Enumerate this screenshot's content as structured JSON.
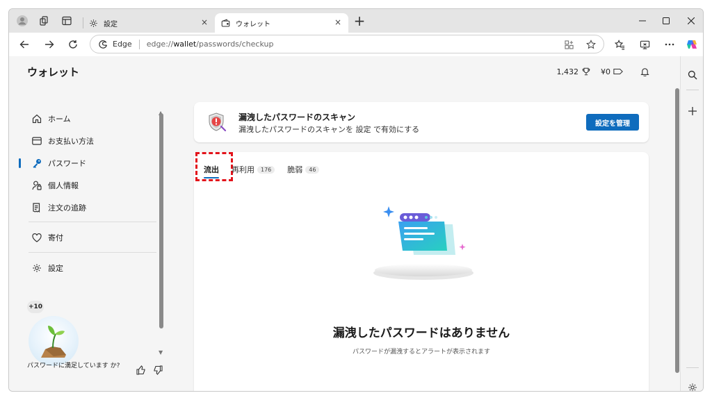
{
  "browser": {
    "tabs": [
      {
        "title": "設定",
        "close": "×"
      },
      {
        "title": "ウォレット",
        "close": "×"
      }
    ],
    "new_tab": "+",
    "address": {
      "edge_label": "Edge",
      "url_prefix": "edge://",
      "url_host": "wallet",
      "url_path": "/passwords/checkup"
    }
  },
  "header": {
    "title": "ウォレット",
    "points": "1,432",
    "cashback": "¥0"
  },
  "nav": {
    "items": [
      {
        "label": "ホーム",
        "icon": "home-icon"
      },
      {
        "label": "お支払い方法",
        "icon": "card-icon"
      },
      {
        "label": "パスワード",
        "icon": "key-icon"
      },
      {
        "label": "個人情報",
        "icon": "person-icon"
      },
      {
        "label": "注文の追跡",
        "icon": "receipt-icon"
      },
      {
        "label": "寄付",
        "icon": "heart-icon"
      },
      {
        "label": "設定",
        "icon": "gear-icon"
      }
    ],
    "active": "パスワード"
  },
  "feedback": {
    "points_badge": "+10",
    "question": "パスワードに満足しています か?"
  },
  "banner": {
    "title": "漏洩したパスワードのスキャン",
    "description": "漏洩したパスワードのスキャンを 設定 で有効にする",
    "button": "設定を管理"
  },
  "password_tabs": [
    {
      "label": "流出",
      "count": ""
    },
    {
      "label": "再利用",
      "count": "176"
    },
    {
      "label": "脆弱",
      "count": "46"
    }
  ],
  "empty_state": {
    "title": "漏洩したパスワードはありません",
    "description": "パスワードが漏洩するとアラートが表示されます"
  },
  "colors": {
    "accent": "#0f6cbd",
    "highlight": "#e3131b"
  }
}
